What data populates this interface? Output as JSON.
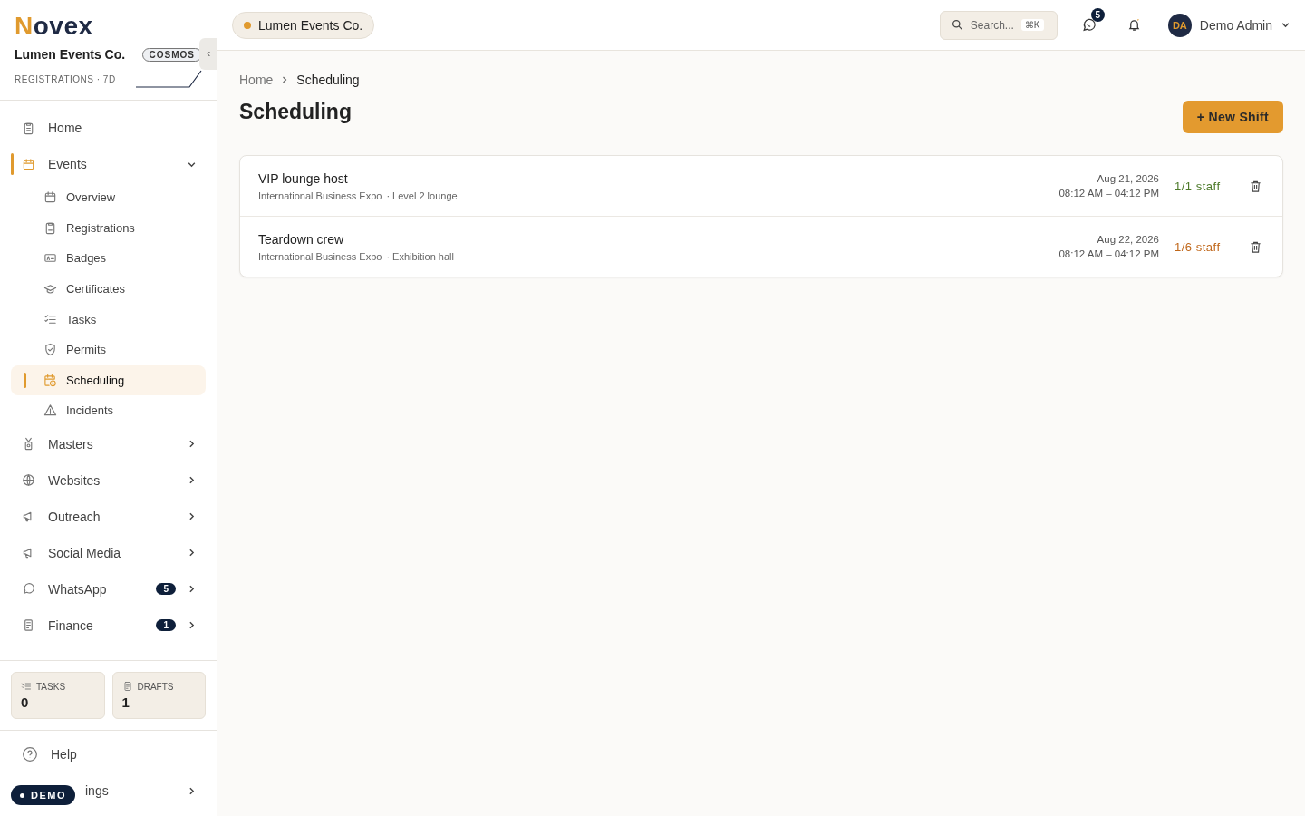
{
  "brand": {
    "logo_letter": "N",
    "logo_rest": "ovex",
    "org": "Lumen Events Co.",
    "plan": "COSMOS",
    "sparkline_label": "REGISTRATIONS · 7D"
  },
  "sidebar": {
    "items": [
      {
        "label": "Home",
        "selected": false
      },
      {
        "label": "Events",
        "selected": true,
        "expanded": true,
        "children": [
          {
            "label": "Overview",
            "selected": false
          },
          {
            "label": "Registrations",
            "selected": false
          },
          {
            "label": "Badges",
            "selected": false
          },
          {
            "label": "Certificates",
            "selected": false
          },
          {
            "label": "Tasks",
            "selected": false
          },
          {
            "label": "Permits",
            "selected": false
          },
          {
            "label": "Scheduling",
            "selected": true
          },
          {
            "label": "Incidents",
            "selected": false
          }
        ]
      },
      {
        "label": "Masters",
        "selected": false,
        "expanded": false
      },
      {
        "label": "Websites",
        "selected": false,
        "expanded": false
      },
      {
        "label": "Outreach",
        "selected": false,
        "expanded": false
      },
      {
        "label": "Social Media",
        "selected": false,
        "expanded": false
      },
      {
        "label": "WhatsApp",
        "selected": false,
        "expanded": false,
        "badge": "5"
      },
      {
        "label": "Finance",
        "selected": false,
        "expanded": false,
        "badge": "1"
      }
    ],
    "stats": [
      {
        "label": "TASKS",
        "value": "0"
      },
      {
        "label": "DRAFTS",
        "value": "1"
      }
    ],
    "footer": [
      {
        "label": "Help"
      },
      {
        "label": "ings",
        "expanded": false
      }
    ],
    "demo_badge": "DEMO"
  },
  "topbar": {
    "org_chip": "Lumen Events Co.",
    "search": {
      "placeholder": "Search...",
      "shortcut": "⌘K"
    },
    "messages_badge": "5",
    "user": {
      "initials": "DA",
      "name": "Demo Admin"
    }
  },
  "breadcrumb": [
    "Home",
    "Scheduling"
  ],
  "title": "Scheduling",
  "new_button": "+ New Shift",
  "shifts": [
    {
      "role": "VIP lounge host",
      "event": "International Business Expo",
      "location": "· Level 2 lounge",
      "date": "Aug 21, 2026",
      "time": "08:12 AM – 04:12 PM",
      "staff": "1/1 staff",
      "fully_staffed": true
    },
    {
      "role": "Teardown crew",
      "event": "International Business Expo",
      "location": "· Exhibition hall",
      "date": "Aug 22, 2026",
      "time": "08:12 AM – 04:12 PM",
      "staff": "1/6 staff",
      "fully_staffed": false
    }
  ]
}
